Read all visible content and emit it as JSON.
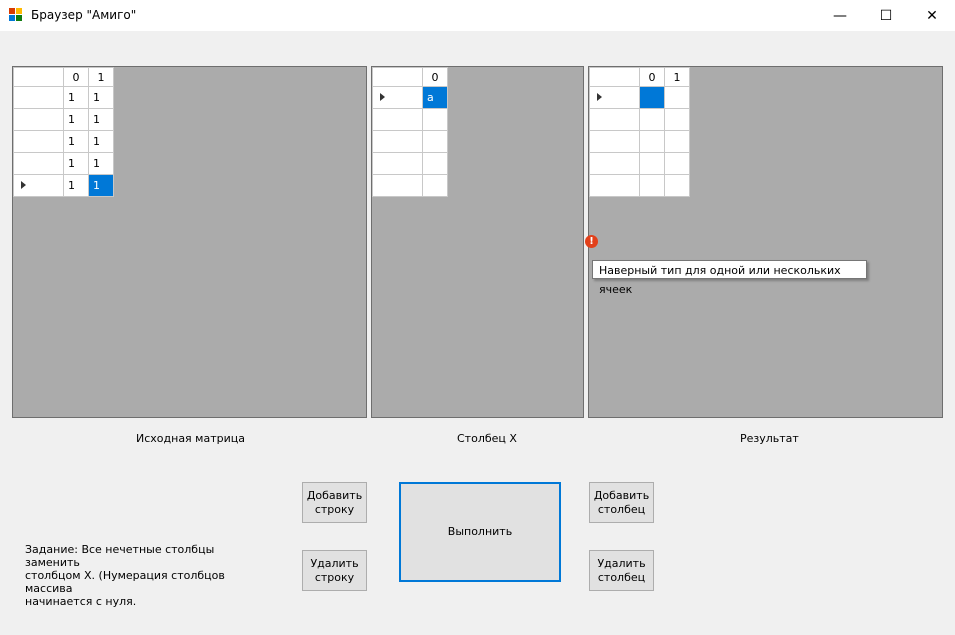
{
  "window": {
    "title": "Браузер \"Амиго\"",
    "minimize": "—",
    "maximize": "☐",
    "close": "✕"
  },
  "grids": {
    "source": {
      "columns": [
        "0",
        "1"
      ],
      "rows": [
        [
          "1",
          "1"
        ],
        [
          "1",
          "1"
        ],
        [
          "1",
          "1"
        ],
        [
          "1",
          "1"
        ],
        [
          "1",
          "1"
        ]
      ],
      "current_row": 4,
      "selected_cell": [
        4,
        1
      ]
    },
    "column_x": {
      "columns": [
        "0"
      ],
      "rows": [
        [
          "a"
        ],
        [
          ""
        ],
        [
          ""
        ],
        [
          ""
        ],
        [
          ""
        ]
      ],
      "current_row": 0,
      "selected_cell": [
        0,
        0
      ]
    },
    "result": {
      "columns": [
        "0",
        "1"
      ],
      "rows": [
        [
          "",
          ""
        ],
        [
          "",
          ""
        ],
        [
          "",
          ""
        ],
        [
          "",
          ""
        ],
        [
          "",
          ""
        ]
      ],
      "current_row": 0,
      "selected_cell": [
        0,
        0
      ]
    }
  },
  "labels": {
    "source": "Исходная матрица",
    "column_x": "Столбец X",
    "result": "Результат"
  },
  "error": {
    "icon": "!",
    "tooltip": "Наверный тип для одной или нескольких ячеек"
  },
  "buttons": {
    "add_row": [
      "Добавить",
      "строку"
    ],
    "delete_row": [
      "Удалить",
      "строку"
    ],
    "execute": "Выполнить",
    "add_column": [
      "Добавить",
      "столбец"
    ],
    "delete_column": [
      "Удалить",
      "столбец"
    ]
  },
  "task": {
    "lines": [
      "Задание: Все нечетные столбцы заменить",
      "столбцом Х. (Нумерация столбцов массива",
      "начинается с нуля."
    ]
  }
}
